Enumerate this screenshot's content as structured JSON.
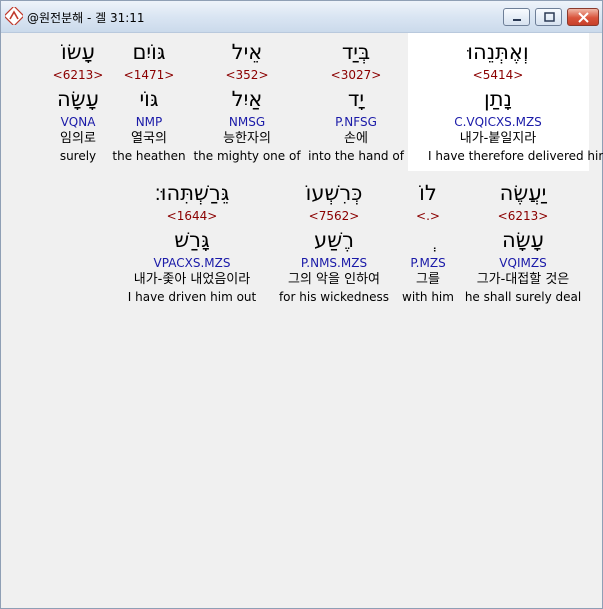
{
  "window": {
    "title": "@원전분해 - 겔 31:11",
    "colors": {
      "strong": "#8b0000",
      "morph": "#1a1aa8",
      "highlight": "#ffffff"
    }
  },
  "line1": [
    {
      "heb": "וְאֶתְּנֵהוּ",
      "num": "<5414>",
      "lemma": "נָתַן",
      "morph": "C.VQICXS.MZS",
      "kor": "내가-붙일지라",
      "eng": "I have therefore delivered him"
    },
    {
      "heb": "בְּיַד",
      "num": "<3027>",
      "lemma": "יָד",
      "morph": "P.NFSG",
      "kor": "손에",
      "eng": "into the hand of"
    },
    {
      "heb": "אֵיל",
      "num": "<352>",
      "lemma": "אַיִל",
      "morph": "NMSG",
      "kor": "능한자의",
      "eng": "the mighty one of"
    },
    {
      "heb": "גּוֹיִם",
      "num": "<1471>",
      "lemma": "גּוֹי",
      "morph": "NMP",
      "kor": "열국의",
      "eng": "the heathen"
    },
    {
      "heb": "עָשׂוֹ",
      "num": "<6213>",
      "lemma": "עָשָׂה",
      "morph": "VQNA",
      "kor": "임의로",
      "eng": "surely"
    }
  ],
  "line2": [
    {
      "heb": "יַעֲשֶׂה",
      "num": "<6213>",
      "lemma": "עָשָׂה",
      "morph": "VQIMZS",
      "kor": "그가-대접할 것은",
      "eng": "he shall surely deal"
    },
    {
      "heb": "לוֹ",
      "num": "<.>",
      "lemma": "ְ",
      "morph": "P.MZS",
      "kor": "그를",
      "eng": "with him"
    },
    {
      "heb": "כְּרִשְׁעוֹ",
      "num": "<7562>",
      "lemma": "רֶשַׁע",
      "morph": "P.NMS.MZS",
      "kor": "그의 악을 인하여",
      "eng": "for his wickedness"
    },
    {
      "heb": "גֵּרַשְׁתִּהוּ׃",
      "num": "<1644>",
      "lemma": "גָּרַשׁ",
      "morph": "VPACXS.MZS",
      "kor": "내가-좇아 내었음이라",
      "eng": "I have driven him out"
    }
  ]
}
